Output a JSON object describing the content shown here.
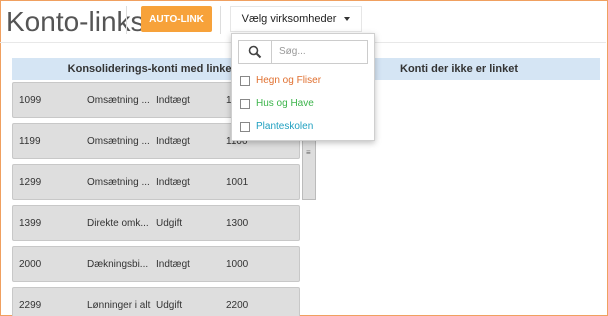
{
  "page": {
    "title": "Konto-links"
  },
  "toolbar": {
    "auto_link_label": "AUTO-LINK",
    "company_select_label": "Vælg virksomheder"
  },
  "left_panel": {
    "header": "Konsoliderings-konti med linkede"
  },
  "right_panel": {
    "header": "Konti der ikke er linket"
  },
  "dropdown": {
    "search_placeholder": "Søg...",
    "options": [
      {
        "label": "Hegn og Fliser",
        "color": "#e07030"
      },
      {
        "label": "Hus og Have",
        "color": "#3cb44b"
      },
      {
        "label": "Planteskolen",
        "color": "#20a0c0"
      }
    ]
  },
  "rows": [
    {
      "number": "1099",
      "name": "Omsætning ...",
      "type": "Indtægt",
      "code": "1000"
    },
    {
      "number": "1199",
      "name": "Omsætning ...",
      "type": "Indtægt",
      "code": "1100"
    },
    {
      "number": "1299",
      "name": "Omsætning ...",
      "type": "Indtægt",
      "code": "1001"
    },
    {
      "number": "1399",
      "name": "Direkte omk...",
      "type": "Udgift",
      "code": "1300"
    },
    {
      "number": "2000",
      "name": "Dækningsbi...",
      "type": "Indtægt",
      "code": "1000"
    },
    {
      "number": "2299",
      "name": "Lønninger i alt",
      "type": "Udgift",
      "code": "2200"
    }
  ]
}
